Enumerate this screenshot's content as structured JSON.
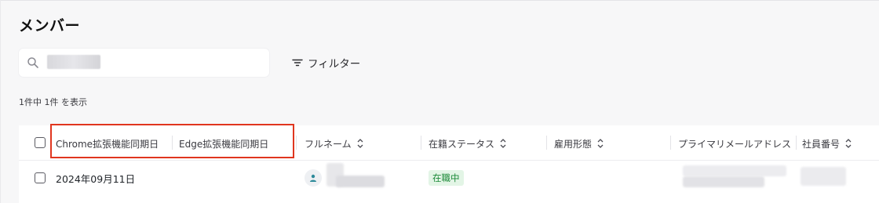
{
  "page": {
    "title": "メンバー"
  },
  "search": {
    "placeholder": ""
  },
  "filter": {
    "label": "フィルター",
    "icon": "filter-icon"
  },
  "result_count": "1件中 1件 を表示",
  "table": {
    "columns": [
      {
        "label": "Chrome拡張機能同期日",
        "sortable": false
      },
      {
        "label": "Edge拡張機能同期日",
        "sortable": false
      },
      {
        "label": "フルネーム",
        "sortable": true
      },
      {
        "label": "在籍ステータス",
        "sortable": true
      },
      {
        "label": "雇用形態",
        "sortable": true
      },
      {
        "label": "プライマリメールアドレス",
        "sortable": false
      },
      {
        "label": "社員番号",
        "sortable": true
      }
    ],
    "rows": [
      {
        "chrome_sync_date": "2024年09月11日",
        "edge_sync_date": "",
        "status": "在職中"
      }
    ]
  },
  "colors": {
    "highlight": "#e0361f",
    "status_bg": "#e3f5e6",
    "status_text": "#1e8a3a",
    "avatar_icon": "#2d8a9a"
  }
}
